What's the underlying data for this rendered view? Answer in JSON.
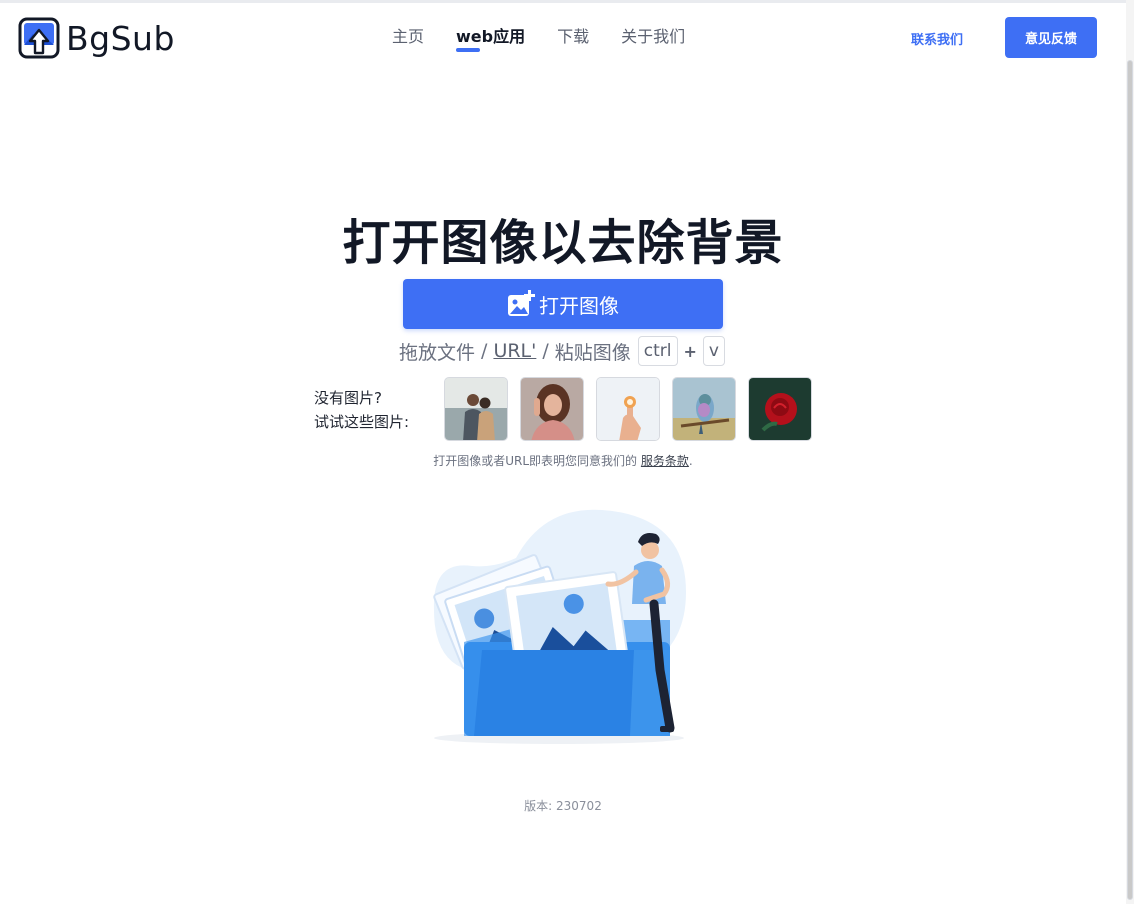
{
  "header": {
    "logo_text": "BgSub",
    "nav": [
      {
        "label": "主页",
        "active": false
      },
      {
        "label": "web应用",
        "active": true
      },
      {
        "label": "下载",
        "active": false
      },
      {
        "label": "关于我们",
        "active": false
      }
    ],
    "contact_label": "联系我们",
    "feedback_label": "意见反馈"
  },
  "hero": {
    "title": "打开图像以去除背景",
    "open_button_label": "打开图像",
    "drop_prefix": "拖放文件",
    "drop_sep1": "/",
    "drop_url": "URL'",
    "drop_sep2": "/",
    "drop_paste": "粘贴图像",
    "key_ctrl": "ctrl",
    "key_plus": "+",
    "key_v": "v"
  },
  "samples": {
    "label_line1": "没有图片?",
    "label_line2": "试试这些图片:",
    "items": [
      "couple-photo",
      "woman-photo",
      "hand-ring-photo",
      "bird-photo",
      "rose-photo"
    ]
  },
  "tos": {
    "text": "打开图像或者URL即表明您同意我们的",
    "link": "服务条款",
    "suffix": "."
  },
  "footer": {
    "version": "版本: 230702"
  },
  "colors": {
    "accent": "#3e6ff4",
    "title": "#121826"
  }
}
